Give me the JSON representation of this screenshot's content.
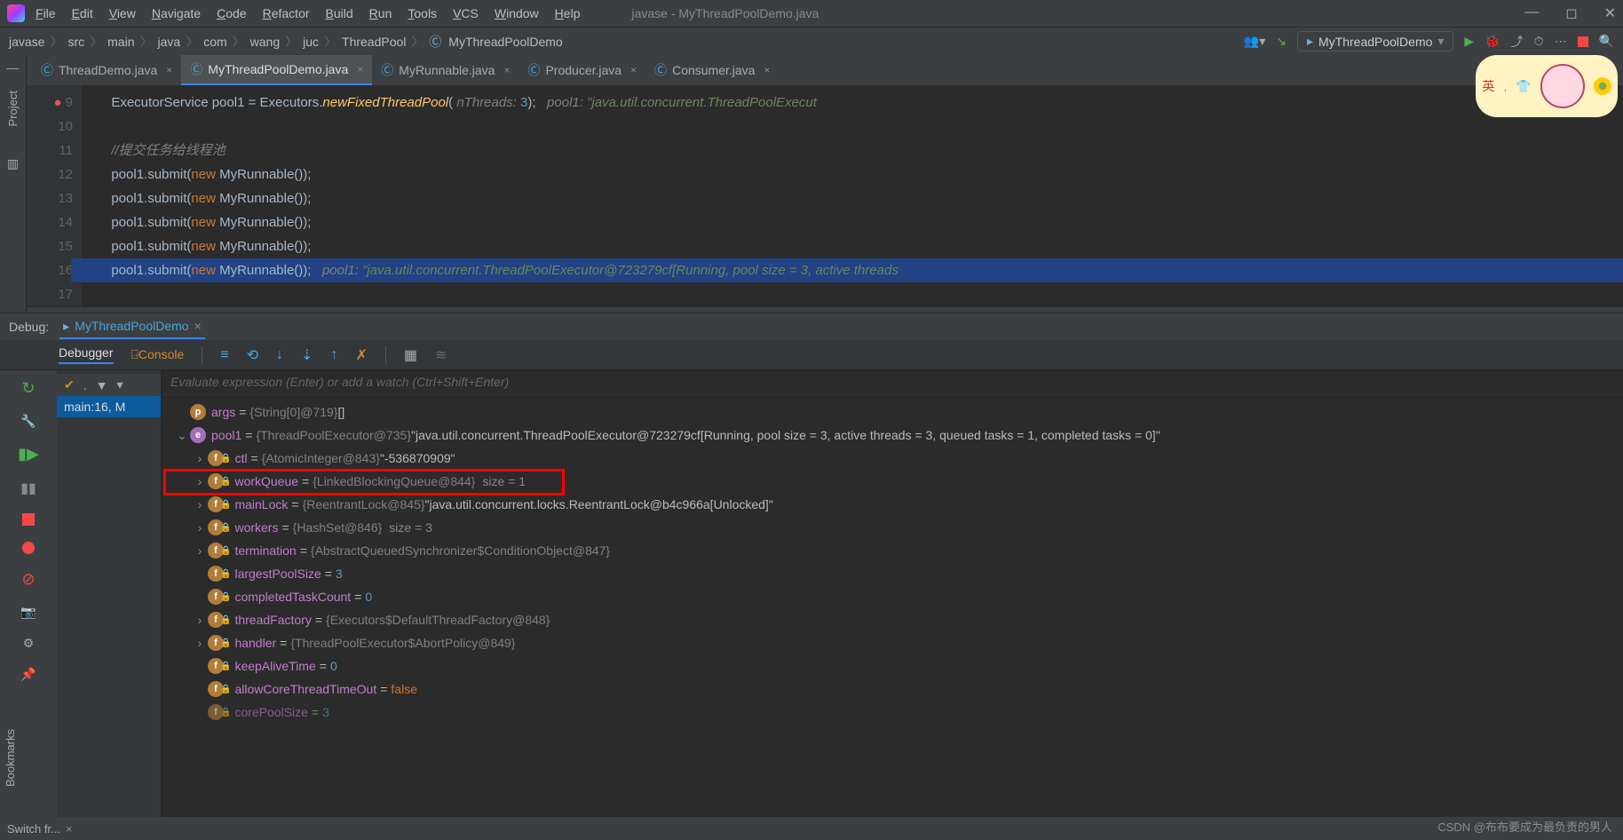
{
  "menu": {
    "items": [
      "File",
      "Edit",
      "View",
      "Navigate",
      "Code",
      "Refactor",
      "Build",
      "Run",
      "Tools",
      "VCS",
      "Window",
      "Help"
    ],
    "title": "javase - MyThreadPoolDemo.java"
  },
  "breadcrumbs": [
    "javase",
    "src",
    "main",
    "java",
    "com",
    "wang",
    "juc",
    "ThreadPool",
    "MyThreadPoolDemo"
  ],
  "run_config": "MyThreadPoolDemo",
  "tabs": [
    {
      "name": "ThreadDemo.java",
      "active": false
    },
    {
      "name": "MyThreadPoolDemo.java",
      "active": true
    },
    {
      "name": "MyRunnable.java",
      "active": false
    },
    {
      "name": "Producer.java",
      "active": false
    },
    {
      "name": "Consumer.java",
      "active": false
    }
  ],
  "code": {
    "lines": [
      {
        "n": 9,
        "bp": true,
        "html": "        ExecutorService pool1 = Executors.<i class='meth' style='font-style:italic'>newFixedThreadPool</i>( <span class='param'>nThreads:</span> <span class='num'>3</span>);   <span class='it'>pool1: </span><span class='str'>\"java.util.concurrent.ThreadPoolExecut</span>"
      },
      {
        "n": 10,
        "html": ""
      },
      {
        "n": 11,
        "html": "        <span class='cmnt'>//提交任务给线程池</span>"
      },
      {
        "n": 12,
        "html": "        pool1.submit(<span class='kw'>new</span> MyRunnable());"
      },
      {
        "n": 13,
        "html": "        pool1.submit(<span class='kw'>new</span> MyRunnable());"
      },
      {
        "n": 14,
        "html": "        pool1.submit(<span class='kw'>new</span> MyRunnable());"
      },
      {
        "n": 15,
        "html": "        pool1.submit(<span class='kw'>new</span> MyRunnable());"
      },
      {
        "n": 16,
        "hl": true,
        "html": "        pool1.submit(<span class='kw'>new</span> MyRunnable());   <span class='it'>pool1: </span><span class='str'>\"java.util.concurrent.ThreadPoolExecutor@723279cf[Running, pool size = 3, active threads </span>"
      },
      {
        "n": 17,
        "html": ""
      }
    ]
  },
  "debug": {
    "label": "Debug:",
    "session": "MyThreadPoolDemo",
    "tabs": {
      "debugger": "Debugger",
      "console": "Console"
    },
    "frame": "main:16, M",
    "eval_placeholder": "Evaluate expression (Enter) or add a watch (Ctrl+Shift+Enter)",
    "vars": [
      {
        "lvl": 1,
        "badge": "p",
        "chev": "",
        "name": "args",
        "type": "{String[0]@719}",
        "val": "[]"
      },
      {
        "lvl": 1,
        "badge": "e",
        "chev": "v",
        "name": "pool1",
        "type": "{ThreadPoolExecutor@735}",
        "val": "\"java.util.concurrent.ThreadPoolExecutor@723279cf[Running, pool size = 3, active threads = 3, queued tasks = 1, completed tasks = 0]\""
      },
      {
        "lvl": 2,
        "badge": "f",
        "chev": ">",
        "name": "ctl",
        "type": "{AtomicInteger@843}",
        "val": "\"-536870909\""
      },
      {
        "lvl": 2,
        "badge": "f",
        "chev": ">",
        "name": "workQueue",
        "type": "{LinkedBlockingQueue@844}",
        "val": "",
        "size": "size = 1",
        "boxed": true
      },
      {
        "lvl": 2,
        "badge": "f",
        "chev": ">",
        "name": "mainLock",
        "type": "{ReentrantLock@845}",
        "val": "\"java.util.concurrent.locks.ReentrantLock@b4c966a[Unlocked]\""
      },
      {
        "lvl": 2,
        "badge": "f",
        "chev": ">",
        "name": "workers",
        "type": "{HashSet@846}",
        "val": "",
        "size": "size = 3"
      },
      {
        "lvl": 2,
        "badge": "f",
        "chev": ">",
        "name": "termination",
        "type": "{AbstractQueuedSynchronizer$ConditionObject@847}",
        "val": ""
      },
      {
        "lvl": 2,
        "badge": "f",
        "chev": "",
        "name": "largestPoolSize",
        "type": "",
        "num": "3"
      },
      {
        "lvl": 2,
        "badge": "f",
        "chev": "",
        "name": "completedTaskCount",
        "type": "",
        "num": "0"
      },
      {
        "lvl": 2,
        "badge": "f",
        "chev": ">",
        "name": "threadFactory",
        "type": "{Executors$DefaultThreadFactory@848}",
        "val": ""
      },
      {
        "lvl": 2,
        "badge": "f",
        "chev": ">",
        "name": "handler",
        "type": "{ThreadPoolExecutor$AbortPolicy@849}",
        "val": ""
      },
      {
        "lvl": 2,
        "badge": "f",
        "chev": "",
        "name": "keepAliveTime",
        "type": "",
        "num": "0"
      },
      {
        "lvl": 2,
        "badge": "f",
        "chev": "",
        "name": "allowCoreThreadTimeOut",
        "type": "",
        "bool": "false"
      },
      {
        "lvl": 2,
        "badge": "f",
        "chev": "",
        "name": "corePoolSize",
        "type": "",
        "num": "3",
        "faded": true
      }
    ]
  },
  "sidebar": {
    "project": "Project",
    "bookmarks": "Bookmarks",
    "switch": "Switch fr..."
  },
  "avatar": {
    "text": "英"
  },
  "watermark": "CSDN @布布要成为最负责的男人"
}
